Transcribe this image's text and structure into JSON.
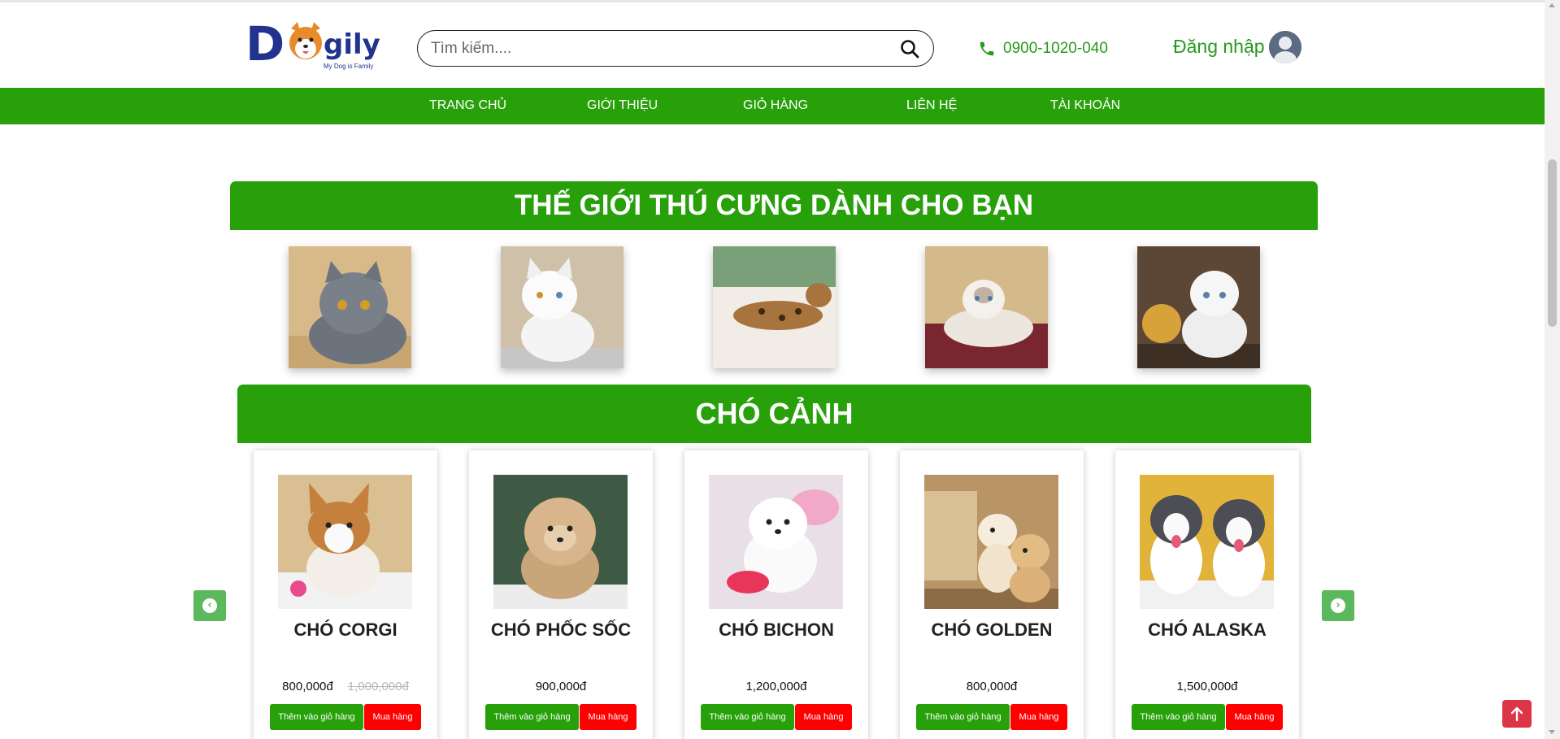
{
  "header": {
    "logo_text_d": "D",
    "logo_text_gily": "gily",
    "logo_tagline": "My Dog is Family",
    "search_placeholder": "Tìm kiếm....",
    "phone": "0900-1020-040",
    "login_label": "Đăng nhập"
  },
  "nav": {
    "items": [
      "TRANG CHỦ",
      "GIỚI THIỆU",
      "GIỎ HÀNG",
      "LIÊN HỆ",
      "TÀI KHOẢN"
    ]
  },
  "sections": {
    "pets_title": "THẾ GIỚI THÚ CƯNG DÀNH CHO BẠN",
    "dogs_title": "CHÓ CẢNH"
  },
  "pets": [
    {
      "icon": "gray-cat-photo",
      "color": "#7a7f88"
    },
    {
      "icon": "white-cat-photo",
      "color": "#efefef"
    },
    {
      "icon": "bengal-cat-photo",
      "color": "#a7743e"
    },
    {
      "icon": "ragdoll-cat-photo",
      "color": "#d9c7b3"
    },
    {
      "icon": "persian-cat-photo",
      "color": "#e6e3df"
    }
  ],
  "products": [
    {
      "name": "CHÓ CORGI",
      "price": "800,000đ",
      "old_price": "1,000,000đ",
      "add_label": "Thêm vào giỏ hàng",
      "buy_label": "Mua hàng"
    },
    {
      "name": "CHÓ PHỐC SỐC",
      "price": "900,000đ",
      "old_price": "",
      "add_label": "Thêm vào giỏ hàng",
      "buy_label": "Mua hàng"
    },
    {
      "name": "CHÓ BICHON",
      "price": "1,200,000đ",
      "old_price": "",
      "add_label": "Thêm vào giỏ hàng",
      "buy_label": "Mua hàng"
    },
    {
      "name": "CHÓ GOLDEN",
      "price": "800,000đ",
      "old_price": "",
      "add_label": "Thêm vào giỏ hàng",
      "buy_label": "Mua hàng"
    },
    {
      "name": "CHÓ ALASKA",
      "price": "1,500,000đ",
      "old_price": "",
      "add_label": "Thêm vào giỏ hàng",
      "buy_label": "Mua hàng"
    }
  ],
  "colors": {
    "brand_green": "#27a00a",
    "buy_red": "#ff0000",
    "logo_blue": "#22338f"
  }
}
